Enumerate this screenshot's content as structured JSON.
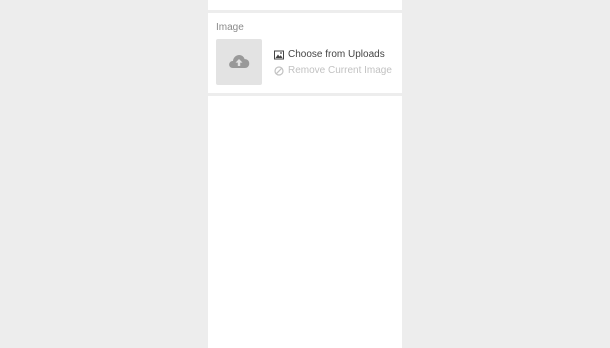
{
  "image_field": {
    "label": "Image",
    "choose_label": "Choose from Uploads",
    "remove_label": "Remove Current Image"
  },
  "icons": {
    "thumbnail": "cloud-upload-icon",
    "choose": "image-icon",
    "remove": "ban-icon"
  },
  "colors": {
    "background": "#ededed",
    "panel": "#ffffff",
    "thumbnail_bg": "#e3e3e3",
    "label": "#8a8a8a",
    "action_active": "#444444",
    "action_disabled": "#c2c2c2"
  }
}
